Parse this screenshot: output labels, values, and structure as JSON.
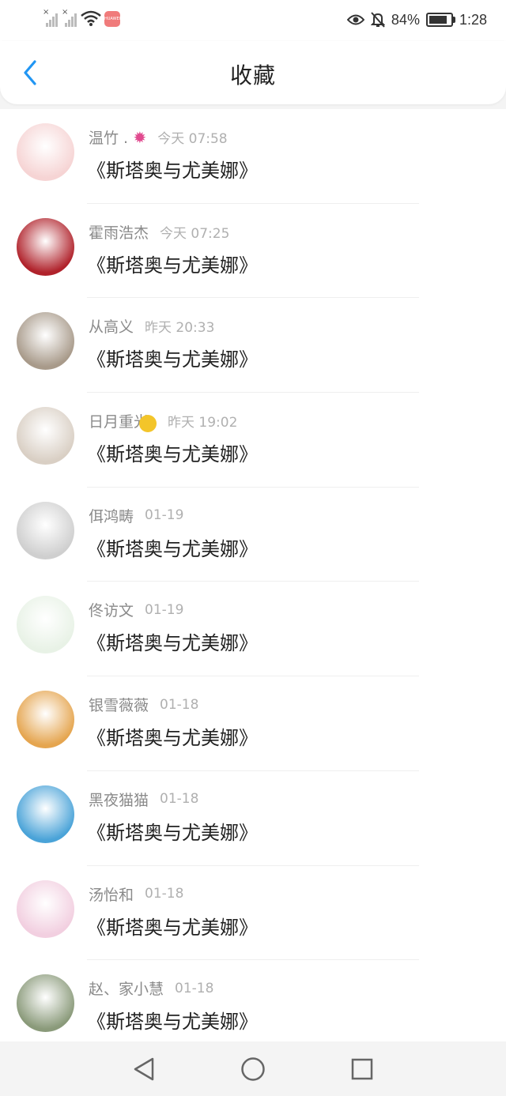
{
  "status_bar": {
    "app_badge_text": "HUAWEI",
    "battery": "84%",
    "battery_level": 0.84,
    "time": "1:28"
  },
  "header": {
    "title": "收藏"
  },
  "colors": {
    "accent": "#2196f3",
    "name_text": "#8a8a8a",
    "time_text": "#b0b0b0"
  },
  "favorites": [
    {
      "name": "温竹 .",
      "emoji": "octopus",
      "time": "今天 07:58",
      "title": "《斯塔奥与尤美娜》",
      "avatar_color": "#f6d4d4"
    },
    {
      "name": "霍雨浩杰",
      "time": "今天 07:25",
      "title": "《斯塔奥与尤美娜》",
      "avatar_color": "#b0222b"
    },
    {
      "name": "从高义",
      "time": "昨天 20:33",
      "title": "《斯塔奥与尤美娜》",
      "avatar_color": "#a89a8a"
    },
    {
      "name": "日月重光",
      "emoji": "moon",
      "time": "昨天 19:02",
      "title": "《斯塔奥与尤美娜》",
      "avatar_color": "#d9cfc4"
    },
    {
      "name": "佴鸿畴",
      "time": "01-19",
      "title": "《斯塔奥与尤美娜》",
      "avatar_color": "#cfcfcf"
    },
    {
      "name": "佟访文",
      "time": "01-19",
      "title": "《斯塔奥与尤美娜》",
      "avatar_color": "#e8f2e6"
    },
    {
      "name": "银雪薇薇",
      "time": "01-18",
      "title": "《斯塔奥与尤美娜》",
      "avatar_color": "#e5a54f"
    },
    {
      "name": "黑夜猫猫",
      "time": "01-18",
      "title": "《斯塔奥与尤美娜》",
      "avatar_color": "#4aa3d8"
    },
    {
      "name": "汤怡和",
      "time": "01-18",
      "title": "《斯塔奥与尤美娜》",
      "avatar_color": "#f2cfe0"
    },
    {
      "name": "赵、家小慧",
      "time": "01-18",
      "title": "《斯塔奥与尤美娜》",
      "avatar_color": "#8a9a7a"
    }
  ]
}
